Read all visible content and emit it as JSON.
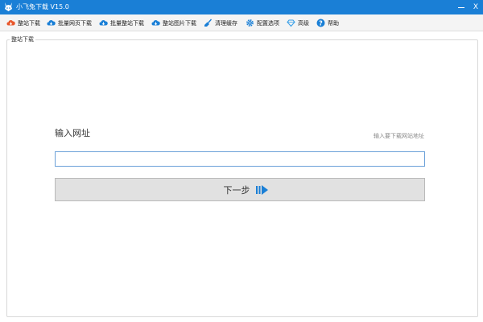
{
  "window": {
    "title": "小飞兔下载 V15.0",
    "close_glyph": "X"
  },
  "toolbar": {
    "items": [
      {
        "label": "整站下载",
        "icon": "cloud-download-icon",
        "color": "#e8572c"
      },
      {
        "label": "批量网页下载",
        "icon": "cloud-download-icon",
        "color": "#1a7fd6"
      },
      {
        "label": "批量整站下载",
        "icon": "cloud-download-icon",
        "color": "#1a7fd6"
      },
      {
        "label": "整站图片下载",
        "icon": "cloud-download-icon",
        "color": "#1a7fd6"
      },
      {
        "label": "清理缓存",
        "icon": "broom-icon",
        "color": "#1a7fd6"
      },
      {
        "label": "配置选项",
        "icon": "gear-icon",
        "color": "#1a7fd6"
      },
      {
        "label": "高级",
        "icon": "diamond-icon",
        "color": "#3aa0e8"
      },
      {
        "label": "帮助",
        "icon": "help-icon",
        "color": "#1a7fd6"
      }
    ]
  },
  "main": {
    "group_title": "整站下载",
    "url_label": "输入网址",
    "url_hint": "输入要下载网站地址",
    "url_value": "",
    "next_button_label": "下一步",
    "next_icon": "arrow-right-icon"
  },
  "colors": {
    "titlebar": "#1a7fd6",
    "accent": "#1a7fd6"
  }
}
